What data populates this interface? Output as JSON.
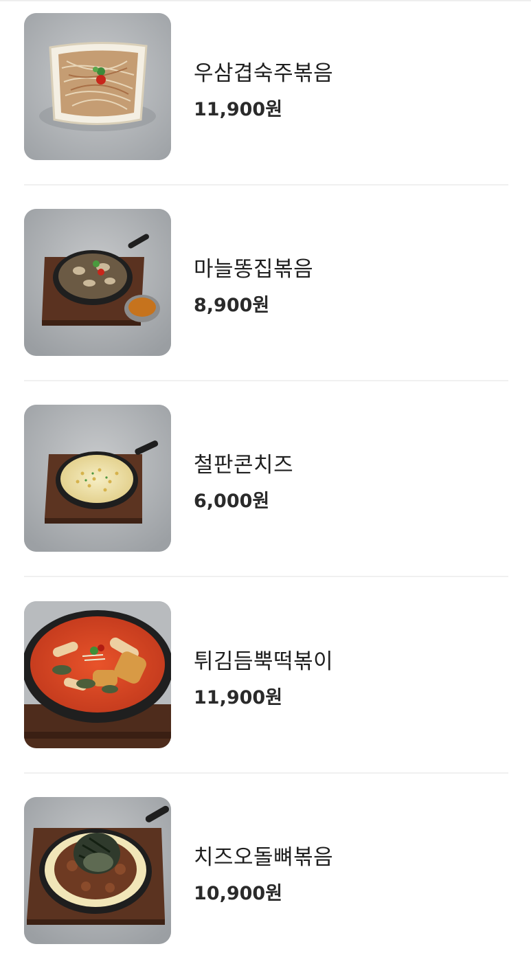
{
  "menu": {
    "items": [
      {
        "name": "우삼겹숙주볶음",
        "price": "11,900원",
        "image": "beef-bean-sprout-stir-fry-photo"
      },
      {
        "name": "마늘똥집볶음",
        "price": "8,900원",
        "image": "garlic-gizzard-skillet-photo"
      },
      {
        "name": "철판콘치즈",
        "price": "6,000원",
        "image": "corn-cheese-skillet-photo"
      },
      {
        "name": "튀김듬뿍떡볶이",
        "price": "11,900원",
        "image": "tteokbokki-pot-photo"
      },
      {
        "name": "치즈오돌뼈볶음",
        "price": "10,900원",
        "image": "cheese-cartilage-skillet-photo"
      }
    ]
  }
}
